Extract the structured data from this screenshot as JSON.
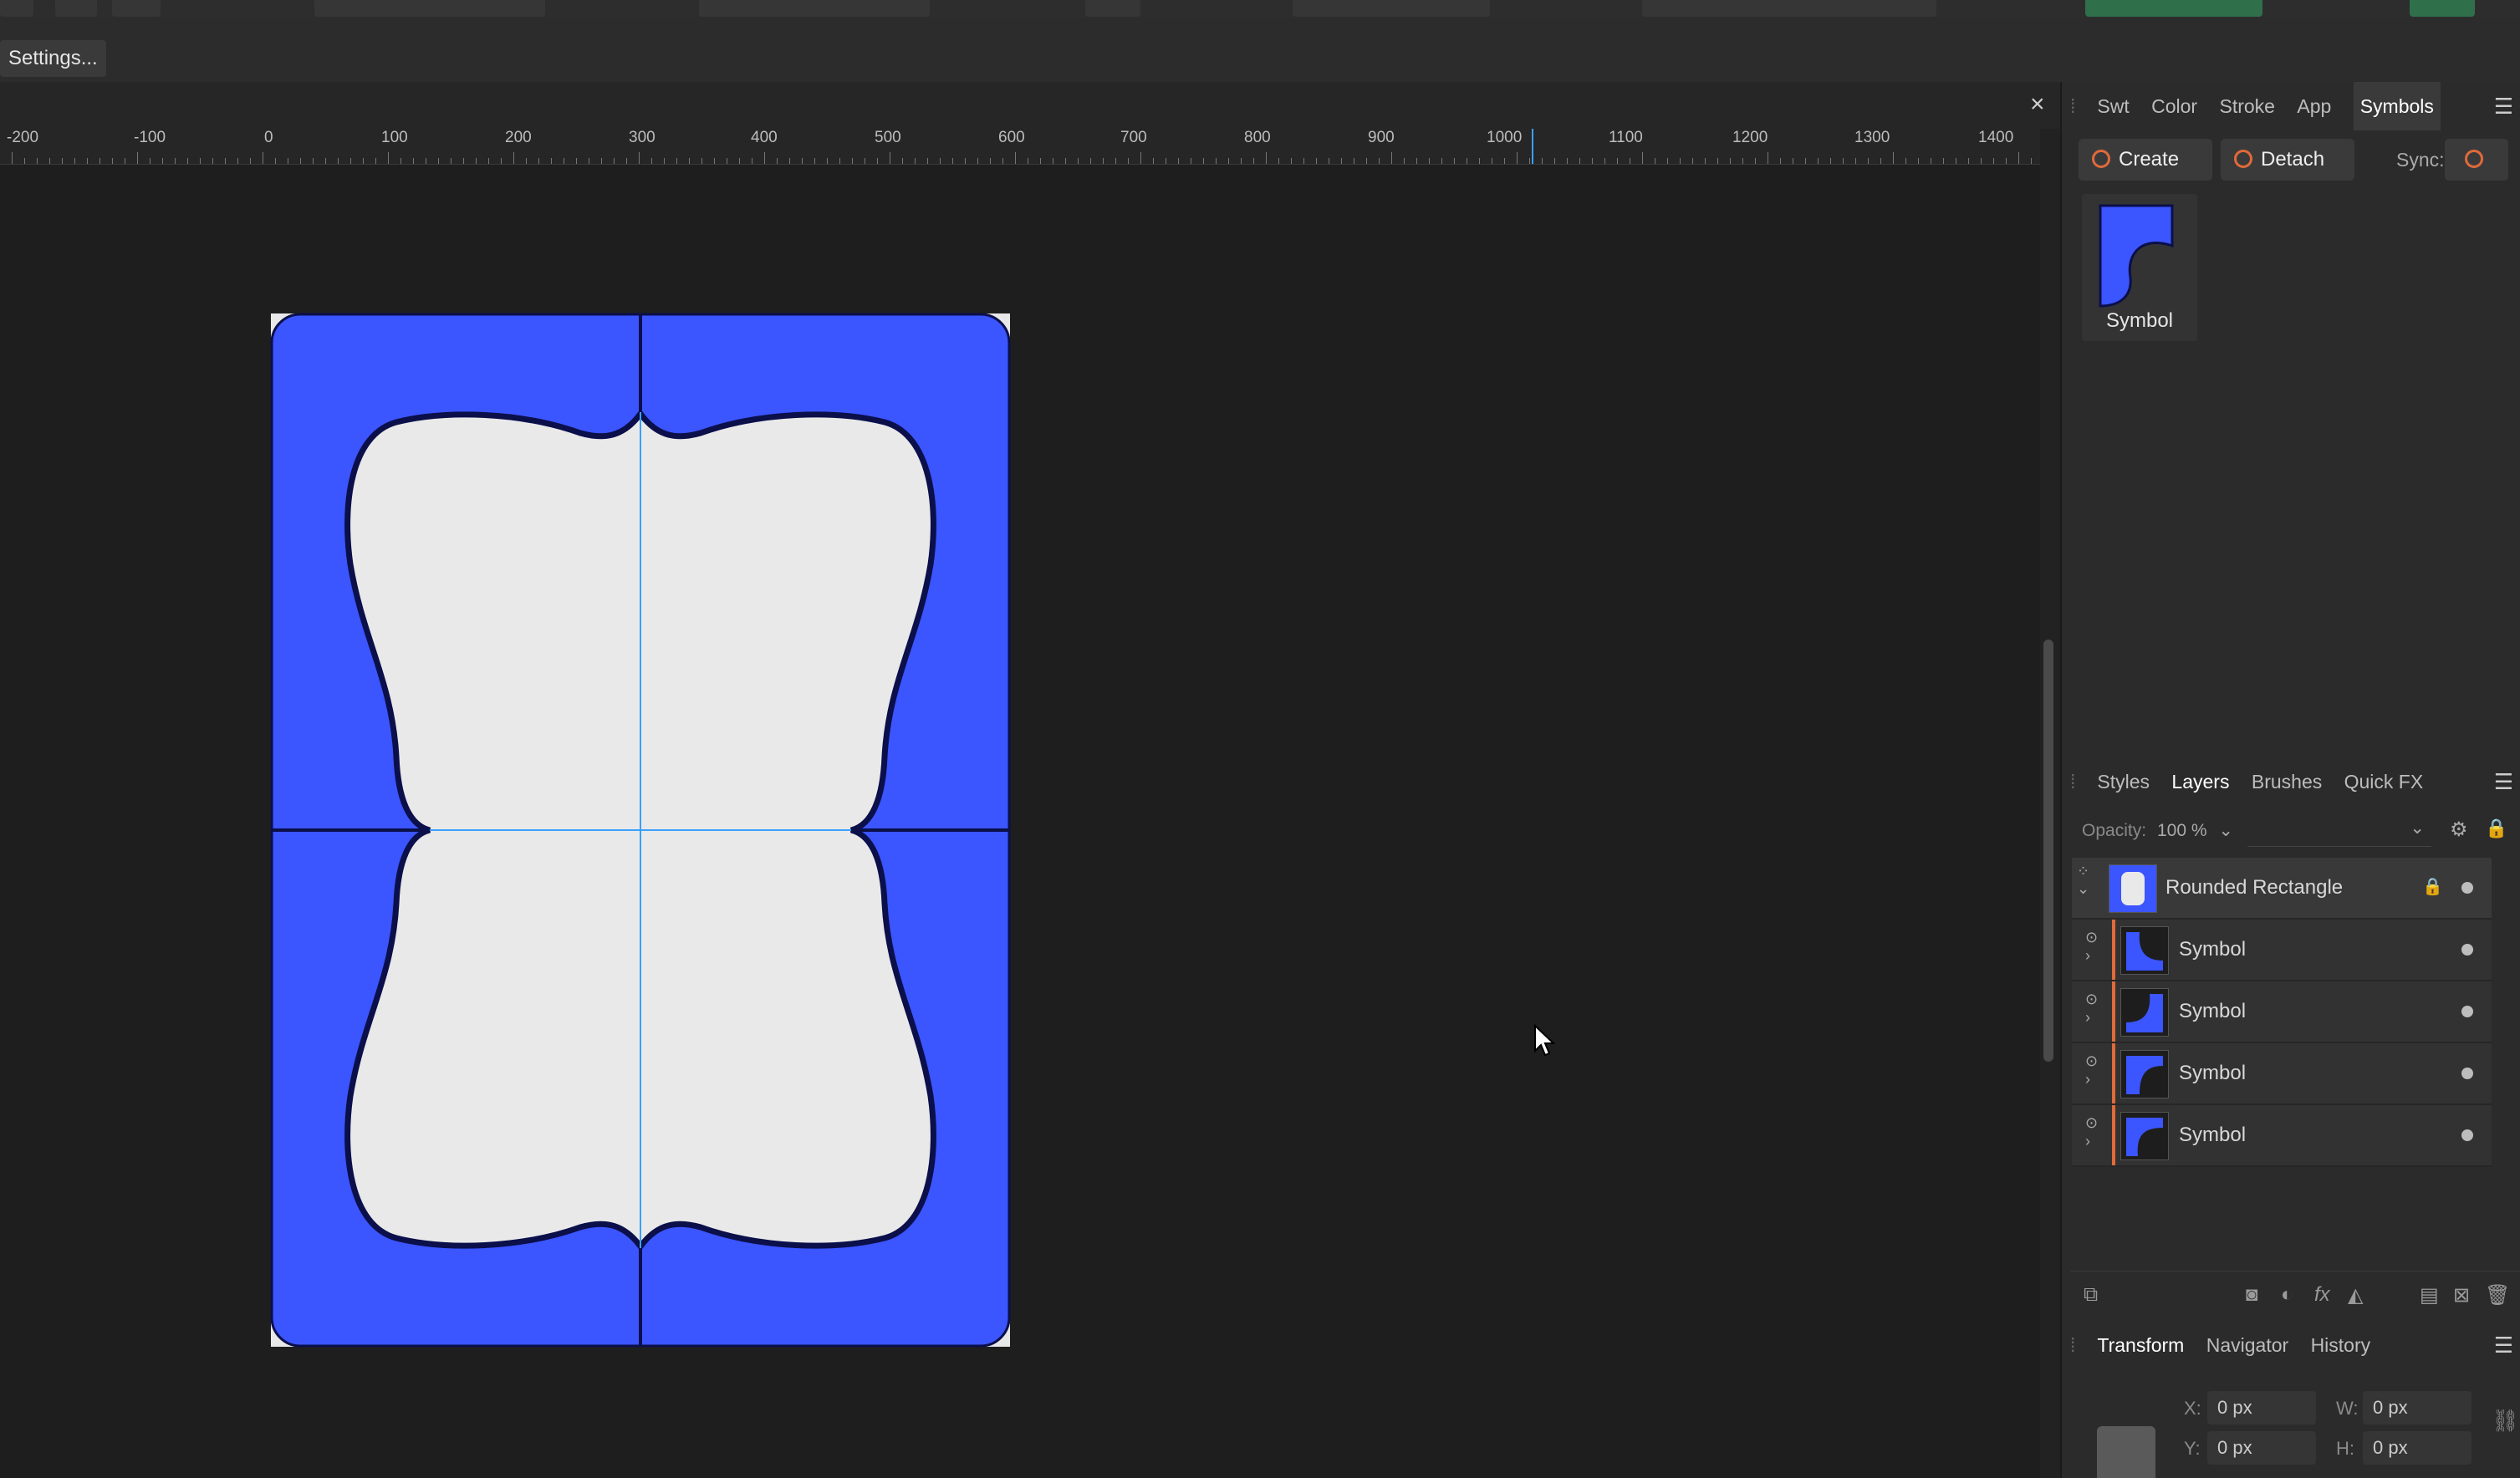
{
  "toolbar": {
    "label": "Top toolbar"
  },
  "context": {
    "settings_label": "Settings..."
  },
  "document": {
    "close_label": "×"
  },
  "ruler": {
    "labels": [
      "-200",
      "-100",
      "0",
      "100",
      "200",
      "300",
      "400",
      "500",
      "600",
      "700",
      "800",
      "900",
      "1000",
      "1100",
      "1200",
      "1300",
      "1400"
    ]
  },
  "symbols_panel": {
    "tabs": [
      "Swt",
      "Color",
      "Stroke",
      "App",
      "Symbols"
    ],
    "active_tab": "Symbols",
    "create_label": "Create",
    "detach_label": "Detach",
    "sync_label": "Sync:",
    "symbol_name": "Symbol"
  },
  "layers_panel": {
    "tabs": [
      "Styles",
      "Layers",
      "Brushes",
      "Quick FX"
    ],
    "active_tab": "Layers",
    "opacity_label": "Opacity:",
    "opacity_value": "100 %",
    "layers": [
      {
        "name": "Rounded Rectangle",
        "locked": true
      },
      {
        "name": "Symbol"
      },
      {
        "name": "Symbol"
      },
      {
        "name": "Symbol"
      },
      {
        "name": "Symbol"
      }
    ]
  },
  "transform_panel": {
    "tabs": [
      "Transform",
      "Navigator",
      "History"
    ],
    "active_tab": "Transform",
    "fields": [
      {
        "label": "X:",
        "value": "0 px"
      },
      {
        "label": "W:",
        "value": "0 px"
      },
      {
        "label": "Y:",
        "value": "0 px"
      },
      {
        "label": "H:",
        "value": "0 px"
      }
    ]
  },
  "colors": {
    "artwork_blue": "#3b55ff",
    "artwork_stroke": "#0b0f4a",
    "guide_blue": "#3aa0ff",
    "accent_orange": "#e06a3a"
  }
}
